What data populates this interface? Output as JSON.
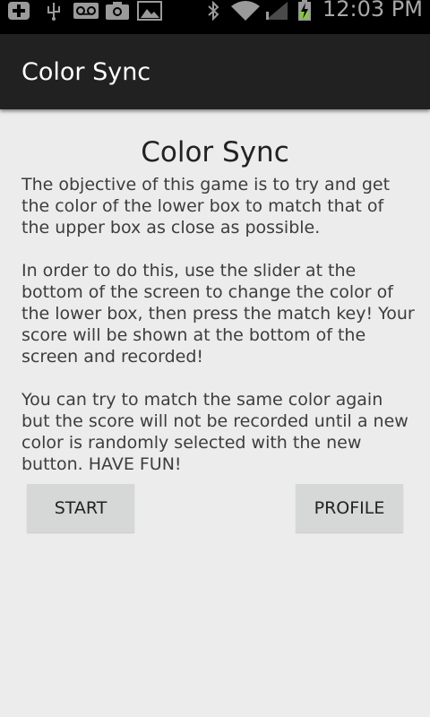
{
  "status_bar": {
    "time": "12:03 PM",
    "icons": [
      "add-icon",
      "usb-icon",
      "voicemail-icon",
      "camera-icon",
      "image-icon",
      "bluetooth-icon",
      "wifi-icon",
      "signal-icon",
      "battery-charging-icon"
    ]
  },
  "action_bar": {
    "title": "Color Sync"
  },
  "main": {
    "heading": "Color Sync",
    "description": "The objective of this game is to try and get the color of the lower box to match that of the upper box as close as possible.\n\n In order to do this, use the slider at the bottom of the screen to change the color of the lower box, then press the match key! Your score will be shown at the bottom of the screen and recorded!\n\n You can try to match the same color again but the score will not be recorded until a new color is randomly selected with the new button. HAVE FUN!",
    "start_label": "START",
    "profile_label": "PROFILE"
  },
  "colors": {
    "status_bar_bg": "#000000",
    "action_bar_bg": "#212121",
    "page_bg": "#ececec",
    "button_bg": "#d6d7d7",
    "battery_accent": "#8bc34a"
  }
}
